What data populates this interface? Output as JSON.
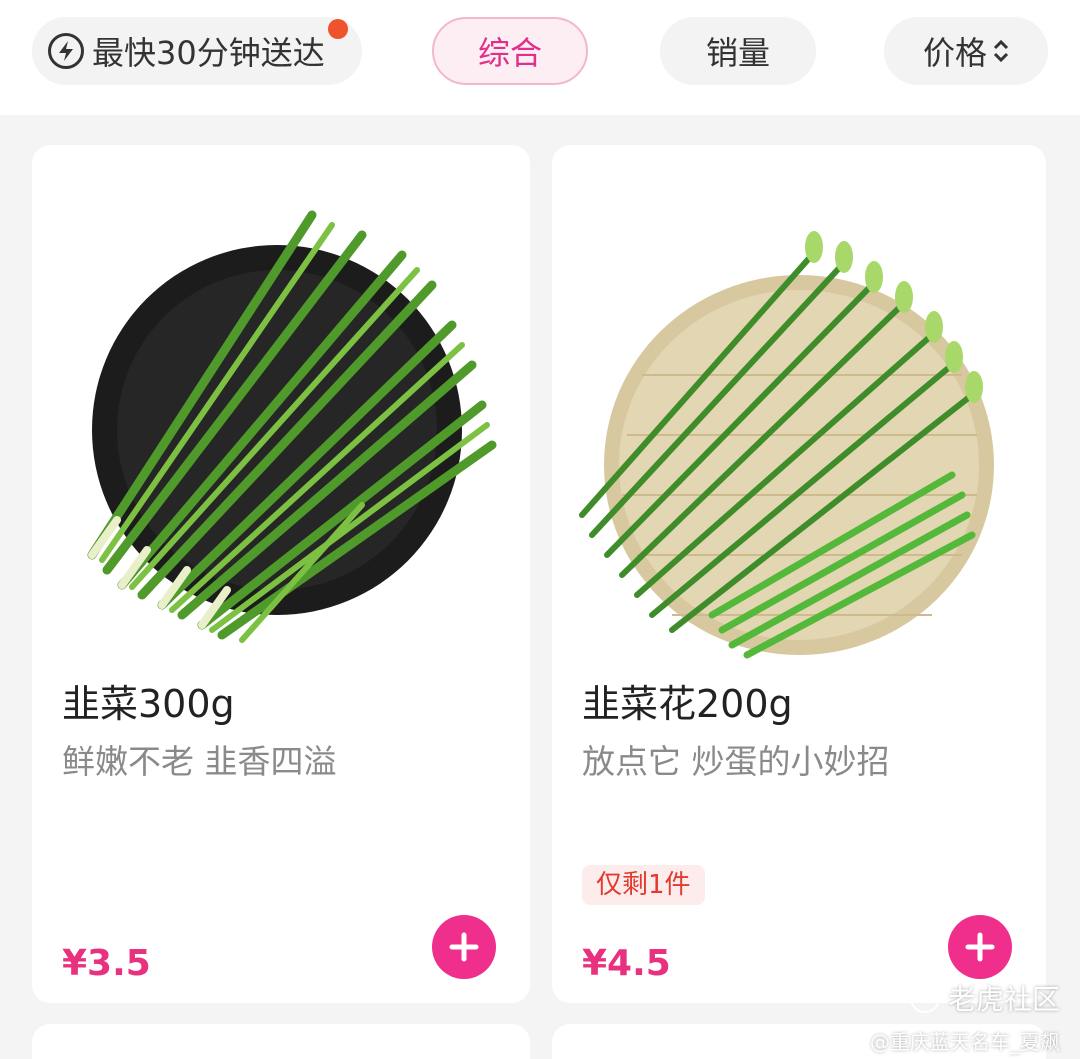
{
  "filters": {
    "fast_delivery": "最快30分钟送达",
    "comprehensive": "综合",
    "sales": "销量",
    "price": "价格"
  },
  "colors": {
    "accent": "#e8327f",
    "add_button": "#f02e8c",
    "selected_chip_bg": "#fdeef4",
    "notification_dot": "#f0522d"
  },
  "products": [
    {
      "title": "韭菜300g",
      "subtitle": "鲜嫩不老 韭香四溢",
      "price": "¥3.5"
    },
    {
      "title": "韭菜花200g",
      "subtitle": "放点它 炒蛋的小妙招",
      "stock": "仅剩1件",
      "price": "¥4.5"
    }
  ],
  "watermark": {
    "brand": "老虎社区",
    "author": "@重庆蓝天名车_夏飙"
  }
}
